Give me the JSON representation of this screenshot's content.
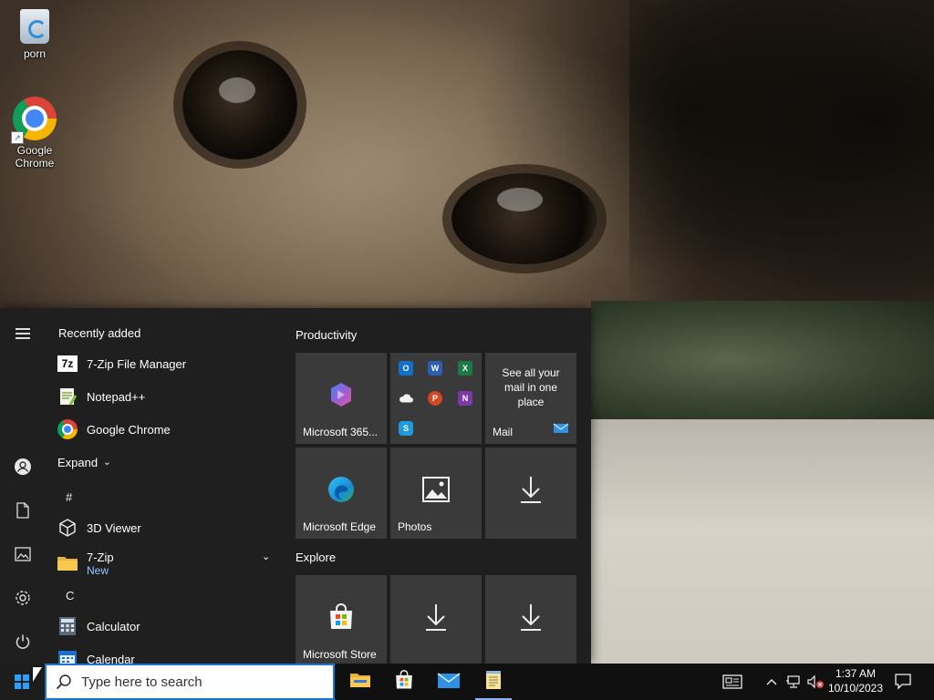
{
  "desktop": {
    "icons": [
      {
        "label": "porn",
        "icon": "recycle-bin-icon"
      },
      {
        "label": "Google Chrome",
        "icon": "chrome-icon"
      }
    ]
  },
  "start_menu": {
    "rail": [
      "hamburger-icon",
      "user-icon",
      "documents-icon",
      "pictures-icon",
      "settings-icon",
      "power-icon"
    ],
    "recently_added_label": "Recently added",
    "recent_apps": [
      {
        "label": "7-Zip File Manager",
        "icon": "7zip-icon"
      },
      {
        "label": "Notepad++",
        "icon": "notepadpp-icon"
      },
      {
        "label": "Google Chrome",
        "icon": "chrome-icon"
      }
    ],
    "expand_label": "Expand",
    "letter_hash": "#",
    "letter_c": "C",
    "apps": [
      {
        "label": "3D Viewer",
        "icon": "cube-icon"
      },
      {
        "label": "7-Zip",
        "sub": "New",
        "icon": "folder-icon"
      },
      {
        "label": "Calculator",
        "icon": "calculator-icon"
      },
      {
        "label": "Calendar",
        "icon": "calendar-icon"
      }
    ],
    "groups": {
      "productivity": "Productivity",
      "explore": "Explore"
    },
    "tiles": {
      "m365": "Microsoft 365...",
      "mail_text": "See all your mail in one place",
      "mail_label": "Mail",
      "edge": "Microsoft Edge",
      "photos": "Photos",
      "store": "Microsoft Store"
    },
    "office_minis": [
      "O",
      "W",
      "X",
      "P",
      "N",
      "S"
    ]
  },
  "taskbar": {
    "search_placeholder": "Type here to search",
    "apps": [
      "file-explorer-icon",
      "store-icon",
      "mail-icon",
      "notepad-icon"
    ],
    "clock_time": "1:37 AM",
    "clock_date": "10/10/2023"
  },
  "colors": {
    "accent": "#2aa0ff",
    "start_bg": "#1f1f1f",
    "tile_bg": "#3a3a3a",
    "taskbar_bg": "#101010"
  }
}
